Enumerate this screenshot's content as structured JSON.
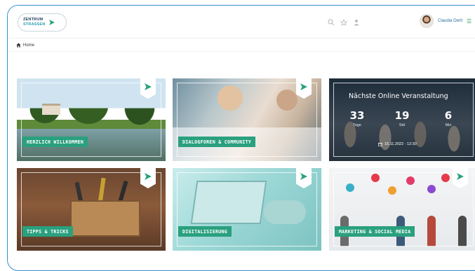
{
  "header": {
    "logo_line1": "ZENTRUM",
    "logo_line2": "STRASSEN",
    "icons": [
      "search-icon",
      "star-icon",
      "user-icon"
    ],
    "user_name": "Claudia Oertl"
  },
  "breadcrumb": {
    "home_label": "Home"
  },
  "tiles": [
    {
      "label": "HERZLICH WILLKOMMEN"
    },
    {
      "label": "DIALOGFOREN & COMMUNITY"
    },
    {
      "label": ""
    },
    {
      "label": "TIPPS & TRICKS"
    },
    {
      "label": "DIGITALISIERUNG"
    },
    {
      "label": "MARKETING & SOCIAL MEDIA"
    }
  ],
  "event": {
    "title": "Nächste Online Veranstaltung",
    "days_value": "33",
    "days_unit": "Tage",
    "hours_value": "19",
    "hours_unit": "Std",
    "minutes_value": "6",
    "minutes_unit": "Min",
    "date_text": "15.11.2022 · 12:30"
  },
  "colors": {
    "accent_green": "#2aa07e",
    "frame_blue": "#2f8ec9"
  }
}
